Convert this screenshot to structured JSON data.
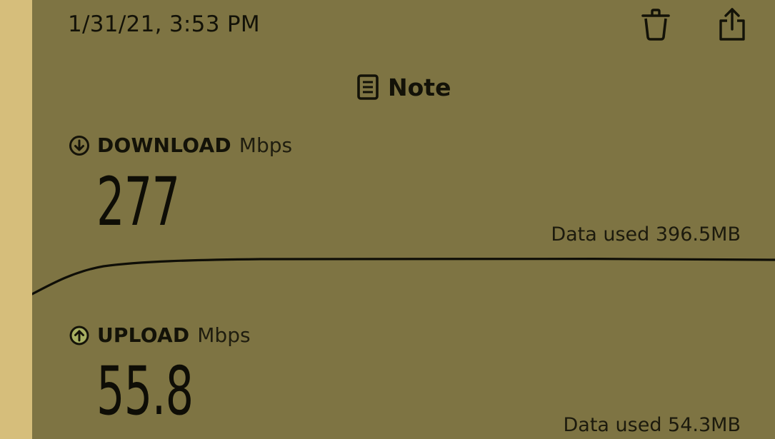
{
  "header": {
    "timestamp": "1/31/21, 3:53 PM",
    "actions": [
      {
        "icon": "trash-icon"
      },
      {
        "icon": "share-icon"
      }
    ]
  },
  "note": {
    "icon": "note-icon",
    "label": "Note"
  },
  "download": {
    "icon": "arrow-down-circle-icon",
    "title": "DOWNLOAD",
    "unit": "Mbps",
    "value": "277",
    "data_used": "Data used 396.5MB"
  },
  "upload": {
    "icon": "arrow-up-circle-icon",
    "title": "UPLOAD",
    "unit": "Mbps",
    "value": "55.8",
    "data_used": "Data used 54.3MB"
  },
  "colors": {
    "panel_background": "#7e7443",
    "left_strip": "#d6be7b",
    "text": "#131208",
    "upload_accent": "#c9e07a"
  }
}
